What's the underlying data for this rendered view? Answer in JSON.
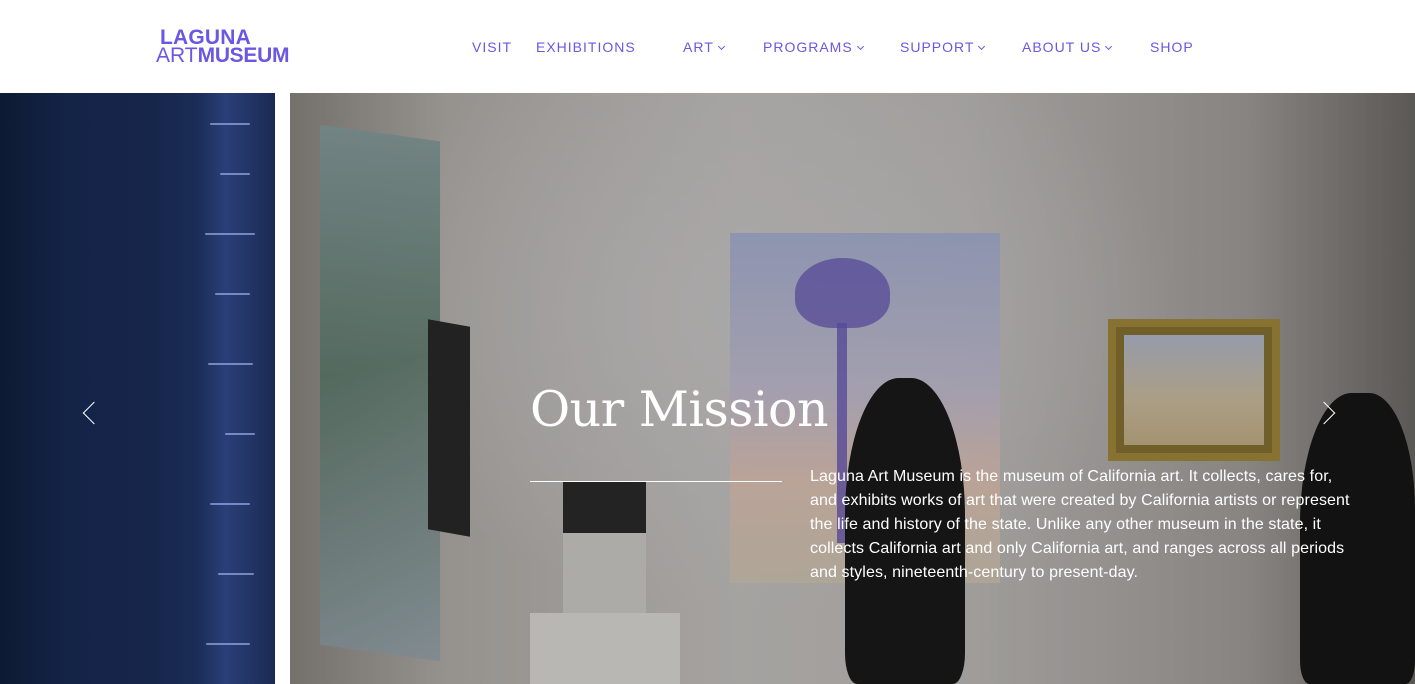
{
  "logo": {
    "line1": "LAGUNA",
    "line2_art": "ART",
    "line2_museum": "MUSEUM"
  },
  "nav": {
    "items": [
      {
        "label": "VISIT",
        "dropdown": false
      },
      {
        "label": "EXHIBITIONS",
        "dropdown": false
      },
      {
        "label": "ART",
        "dropdown": true
      },
      {
        "label": "PROGRAMS",
        "dropdown": true
      },
      {
        "label": "SUPPORT",
        "dropdown": true
      },
      {
        "label": "ABOUT US",
        "dropdown": true
      },
      {
        "label": "SHOP",
        "dropdown": false
      }
    ]
  },
  "hero": {
    "title": "Our Mission",
    "body": "Laguna Art Museum is the museum of California art. It collects, cares for, and exhibits works of art that were created by California artists or represent the life and history of the state. Unlike any other museum in the state, it collects California art and only California art, and ranges across all periods and styles, nineteenth-century to present-day."
  },
  "icons": {
    "prev": "chevron-left-icon",
    "next": "chevron-right-icon",
    "dropdown": "chevron-down-icon"
  },
  "colors": {
    "brand": "#6b57e3",
    "text_on_image": "#ffffff"
  }
}
